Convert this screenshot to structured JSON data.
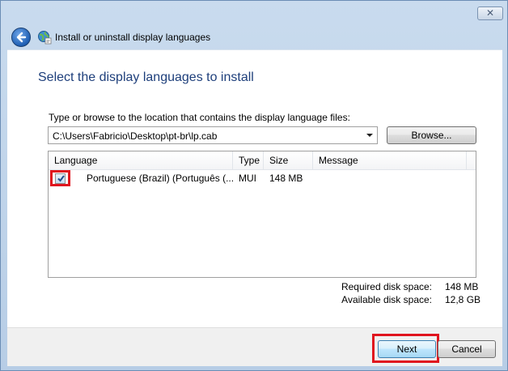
{
  "window": {
    "title": "Install or uninstall display languages",
    "close_glyph": "✕"
  },
  "icons": {
    "back": "back-arrow-icon",
    "title": "globe-language-icon",
    "close": "close-icon",
    "dropdown": "chevron-down-icon",
    "check": "check-icon"
  },
  "page": {
    "heading": "Select the display languages to install",
    "prompt": "Type or browse to the location that contains the display language files:",
    "path_value": "C:\\Users\\Fabricio\\Desktop\\pt-br\\lp.cab",
    "browse_label": "Browse..."
  },
  "list": {
    "columns": [
      "Language",
      "Type",
      "Size",
      "Message"
    ],
    "rows": [
      {
        "checked": true,
        "language": "Portuguese (Brazil) (Português (...",
        "type": "MUI",
        "size": "148 MB",
        "message": ""
      }
    ]
  },
  "disk": {
    "required_label": "Required disk space:",
    "required_value": "148 MB",
    "available_label": "Available disk space:",
    "available_value": "12,8 GB"
  },
  "buttons": {
    "next": "Next",
    "cancel": "Cancel"
  },
  "colors": {
    "heading": "#1e3f7b",
    "highlight": "#e0141e"
  }
}
